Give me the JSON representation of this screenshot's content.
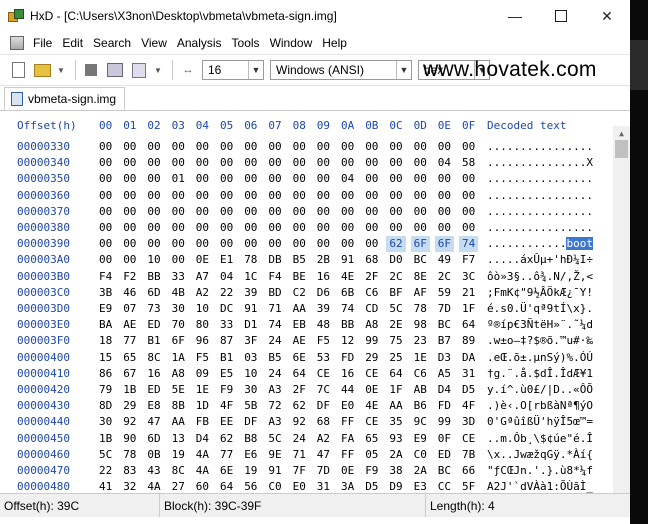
{
  "window": {
    "title": "HxD - [C:\\Users\\X3non\\Desktop\\vbmeta\\vbmeta-sign.img]"
  },
  "menu": [
    "File",
    "Edit",
    "Search",
    "View",
    "Analysis",
    "Tools",
    "Window",
    "Help"
  ],
  "toolbar": {
    "bytes_per_row": "16",
    "charset": "Windows (ANSI)",
    "display_mode": "hex"
  },
  "watermark": "www.hovatek.com",
  "tab": {
    "label": "vbmeta-sign.img"
  },
  "hex": {
    "offset_header": "Offset(h)",
    "column_headers": [
      "00",
      "01",
      "02",
      "03",
      "04",
      "05",
      "06",
      "07",
      "08",
      "09",
      "0A",
      "0B",
      "0C",
      "0D",
      "0E",
      "0F"
    ],
    "decoded_header": "Decoded text",
    "rows": [
      {
        "offset": "00000330",
        "bytes": [
          "00",
          "00",
          "00",
          "00",
          "00",
          "00",
          "00",
          "00",
          "00",
          "00",
          "00",
          "00",
          "00",
          "00",
          "00",
          "00"
        ],
        "text": "................"
      },
      {
        "offset": "00000340",
        "bytes": [
          "00",
          "00",
          "00",
          "00",
          "00",
          "00",
          "00",
          "00",
          "00",
          "00",
          "00",
          "00",
          "00",
          "00",
          "04",
          "58"
        ],
        "text": "...............X"
      },
      {
        "offset": "00000350",
        "bytes": [
          "00",
          "00",
          "00",
          "01",
          "00",
          "00",
          "00",
          "00",
          "00",
          "00",
          "04",
          "00",
          "00",
          "00",
          "00",
          "00"
        ],
        "text": "................"
      },
      {
        "offset": "00000360",
        "bytes": [
          "00",
          "00",
          "00",
          "00",
          "00",
          "00",
          "00",
          "00",
          "00",
          "00",
          "00",
          "00",
          "00",
          "00",
          "00",
          "00"
        ],
        "text": "................"
      },
      {
        "offset": "00000370",
        "bytes": [
          "00",
          "00",
          "00",
          "00",
          "00",
          "00",
          "00",
          "00",
          "00",
          "00",
          "00",
          "00",
          "00",
          "00",
          "00",
          "00"
        ],
        "text": "................"
      },
      {
        "offset": "00000380",
        "bytes": [
          "00",
          "00",
          "00",
          "00",
          "00",
          "00",
          "00",
          "00",
          "00",
          "00",
          "00",
          "00",
          "00",
          "00",
          "00",
          "00"
        ],
        "text": "................"
      },
      {
        "offset": "00000390",
        "bytes": [
          "00",
          "00",
          "00",
          "00",
          "00",
          "00",
          "00",
          "00",
          "00",
          "00",
          "00",
          "00",
          "62",
          "6F",
          "6F",
          "74"
        ],
        "text": "............boot"
      },
      {
        "offset": "000003A0",
        "bytes": [
          "00",
          "00",
          "10",
          "00",
          "0E",
          "E1",
          "78",
          "DB",
          "B5",
          "2B",
          "91",
          "68",
          "D0",
          "BC",
          "49",
          "F7"
        ],
        "text": ".....áxÛµ+'hÐ¼I÷"
      },
      {
        "offset": "000003B0",
        "bytes": [
          "F4",
          "F2",
          "BB",
          "33",
          "A7",
          "04",
          "1C",
          "F4",
          "BE",
          "16",
          "4E",
          "2F",
          "2C",
          "8E",
          "2C",
          "3C"
        ],
        "text": "ôò»3§..ô¾.N/,Ž,<"
      },
      {
        "offset": "000003C0",
        "bytes": [
          "3B",
          "46",
          "6D",
          "4B",
          "A2",
          "22",
          "39",
          "BD",
          "C2",
          "D6",
          "6B",
          "C6",
          "BF",
          "AF",
          "59",
          "21"
        ],
        "text": ";FmK¢\"9½ÂÖkÆ¿¯Y!"
      },
      {
        "offset": "000003D0",
        "bytes": [
          "E9",
          "07",
          "73",
          "30",
          "10",
          "DC",
          "91",
          "71",
          "AA",
          "39",
          "74",
          "CD",
          "5C",
          "78",
          "7D",
          "1F"
        ],
        "text": "é.s0.Ü'qª9tÍ\\x}."
      },
      {
        "offset": "000003E0",
        "bytes": [
          "BA",
          "AE",
          "ED",
          "70",
          "80",
          "33",
          "D1",
          "74",
          "EB",
          "48",
          "BB",
          "A8",
          "2E",
          "98",
          "BC",
          "64"
        ],
        "text": "º®íp€3ÑtëH»¨.˜¼d"
      },
      {
        "offset": "000003F0",
        "bytes": [
          "18",
          "77",
          "B1",
          "6F",
          "96",
          "87",
          "3F",
          "24",
          "AE",
          "F5",
          "12",
          "99",
          "75",
          "23",
          "B7",
          "89"
        ],
        "text": ".w±o–‡?$®õ.™u#·‰"
      },
      {
        "offset": "00000400",
        "bytes": [
          "15",
          "65",
          "8C",
          "1A",
          "F5",
          "B1",
          "03",
          "B5",
          "6E",
          "53",
          "FD",
          "29",
          "25",
          "1E",
          "D3",
          "DA"
        ],
        "text": ".eŒ.õ±.µnSý)%.ÓÚ"
      },
      {
        "offset": "00000410",
        "bytes": [
          "86",
          "67",
          "16",
          "A8",
          "09",
          "E5",
          "10",
          "24",
          "64",
          "CE",
          "16",
          "CE",
          "64",
          "C6",
          "A5",
          "31"
        ],
        "text": "†g.¨.å.$dÎ.ÎdÆ¥1"
      },
      {
        "offset": "00000420",
        "bytes": [
          "79",
          "1B",
          "ED",
          "5E",
          "1E",
          "F9",
          "30",
          "A3",
          "2F",
          "7C",
          "44",
          "0E",
          "1F",
          "AB",
          "D4",
          "D5"
        ],
        "text": "y.í^.ù0£/|D..«ÔÕ"
      },
      {
        "offset": "00000430",
        "bytes": [
          "8D",
          "29",
          "E8",
          "8B",
          "1D",
          "4F",
          "5B",
          "72",
          "62",
          "DF",
          "E0",
          "4E",
          "AA",
          "B6",
          "FD",
          "4F"
        ],
        "text": ".)è‹.O[rbßàNª¶ýO"
      },
      {
        "offset": "00000440",
        "bytes": [
          "30",
          "92",
          "47",
          "AA",
          "FB",
          "EE",
          "DF",
          "A3",
          "92",
          "68",
          "FF",
          "CE",
          "35",
          "9C",
          "99",
          "3D"
        ],
        "text": "0'GªûîßÜ'hÿÎ5œ™="
      },
      {
        "offset": "00000450",
        "bytes": [
          "1B",
          "90",
          "6D",
          "13",
          "D4",
          "62",
          "B8",
          "5C",
          "24",
          "A2",
          "FA",
          "65",
          "93",
          "E9",
          "0F",
          "CE"
        ],
        "text": "..m.Ôb¸\\$¢úe\"é.Î"
      },
      {
        "offset": "00000460",
        "bytes": [
          "5C",
          "78",
          "0B",
          "19",
          "4A",
          "77",
          "E6",
          "9E",
          "71",
          "47",
          "FF",
          "05",
          "2A",
          "C0",
          "ED",
          "7B"
        ],
        "text": "\\x..JwæžqGÿ.*Àí{"
      },
      {
        "offset": "00000470",
        "bytes": [
          "22",
          "83",
          "43",
          "8C",
          "4A",
          "6E",
          "19",
          "91",
          "7F",
          "7D",
          "0E",
          "F9",
          "38",
          "2A",
          "BC",
          "66"
        ],
        "text": "\"ƒCŒJn.'.}.ù8*¼f"
      },
      {
        "offset": "00000480",
        "bytes": [
          "41",
          "32",
          "4A",
          "27",
          "60",
          "64",
          "56",
          "C0",
          "E0",
          "31",
          "3A",
          "D5",
          "D9",
          "E3",
          "CC",
          "5F"
        ],
        "text": "A2J'`dVÀà1:ÕÙãÌ_"
      }
    ]
  },
  "status": {
    "offset": "Offset(h): 39C",
    "block": "Block(h): 39C-39F",
    "length": "Length(h): 4"
  },
  "colors": {
    "offset_blue": "#1f47a8",
    "selection": "#c6dcf2",
    "selection_active": "#3d78d0"
  },
  "icons": [
    "hxd-app-icon",
    "minimize-icon",
    "maximize-icon",
    "close-icon",
    "new-file-icon",
    "open-folder-icon",
    "save-icon",
    "print-icon",
    "bytes-per-row-icon",
    "file-tab-icon"
  ]
}
